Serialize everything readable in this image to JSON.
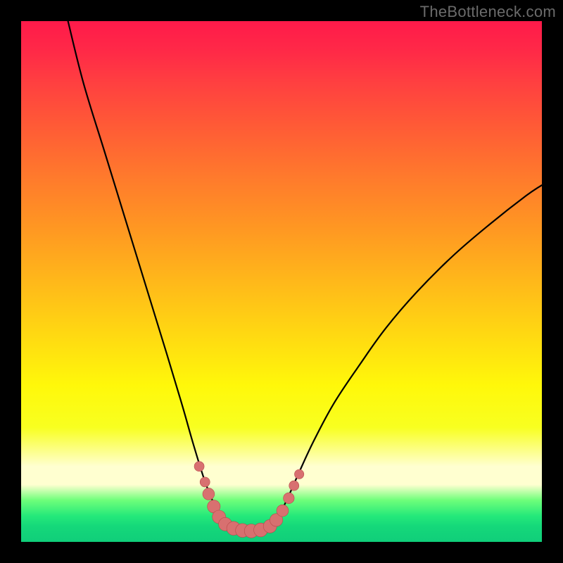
{
  "watermark": "TheBottleneck.com",
  "colors": {
    "background": "#000000",
    "gradient_top": "#ff1a4a",
    "gradient_mid": "#fff80a",
    "gradient_band": "#ffffd0",
    "gradient_bottom": "#10ce7a",
    "curve_stroke": "#000000",
    "marker_fill": "#d87070",
    "marker_stroke": "#b84a4a"
  },
  "chart_data": {
    "type": "line",
    "title": "",
    "xlabel": "",
    "ylabel": "",
    "xlim": [
      0,
      100
    ],
    "ylim": [
      0,
      100
    ],
    "series": [
      {
        "name": "bottleneck-curve",
        "x": [
          9,
          12,
          16,
          20,
          24,
          28,
          31,
          33,
          35,
          36.5,
          38,
          40,
          42,
          44,
          46,
          48,
          49.5,
          51,
          53,
          56,
          60,
          65,
          70,
          76,
          83,
          90,
          97,
          100
        ],
        "y": [
          100,
          88,
          75,
          62,
          49,
          36,
          26,
          19,
          12.5,
          8.5,
          5.5,
          3,
          2.2,
          2,
          2.2,
          3.2,
          5.2,
          8,
          12.5,
          19,
          26.5,
          34,
          41,
          48,
          55,
          61,
          66.5,
          68.5
        ]
      }
    ],
    "markers": [
      {
        "x": 34.2,
        "y": 14.5,
        "r": 1.0
      },
      {
        "x": 35.3,
        "y": 11.5,
        "r": 1.0
      },
      {
        "x": 36.0,
        "y": 9.2,
        "r": 1.2
      },
      {
        "x": 37.0,
        "y": 6.8,
        "r": 1.3
      },
      {
        "x": 38.0,
        "y": 4.8,
        "r": 1.35
      },
      {
        "x": 39.2,
        "y": 3.4,
        "r": 1.35
      },
      {
        "x": 40.8,
        "y": 2.6,
        "r": 1.4
      },
      {
        "x": 42.5,
        "y": 2.2,
        "r": 1.4
      },
      {
        "x": 44.2,
        "y": 2.1,
        "r": 1.4
      },
      {
        "x": 46.0,
        "y": 2.3,
        "r": 1.4
      },
      {
        "x": 47.8,
        "y": 3.0,
        "r": 1.35
      },
      {
        "x": 49.0,
        "y": 4.2,
        "r": 1.3
      },
      {
        "x": 50.2,
        "y": 6.0,
        "r": 1.2
      },
      {
        "x": 51.4,
        "y": 8.4,
        "r": 1.1
      },
      {
        "x": 52.4,
        "y": 10.8,
        "r": 1.0
      },
      {
        "x": 53.4,
        "y": 13.0,
        "r": 0.95
      }
    ]
  }
}
